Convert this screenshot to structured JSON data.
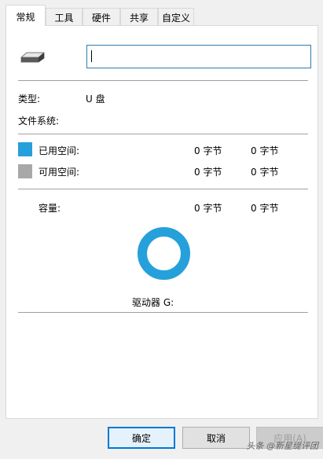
{
  "tabs": [
    {
      "label": "常规",
      "active": true
    },
    {
      "label": "工具",
      "active": false
    },
    {
      "label": "硬件",
      "active": false
    },
    {
      "label": "共享",
      "active": false
    },
    {
      "label": "自定义",
      "active": false
    }
  ],
  "drive": {
    "icon": "usb-drive-icon",
    "name_value": ""
  },
  "info": {
    "type_label": "类型:",
    "type_value": "U 盘",
    "fs_label": "文件系统:",
    "fs_value": ""
  },
  "space": {
    "used_label": "已用空间:",
    "used_bytes": "0 字节",
    "used_size": "0 字节",
    "used_color": "#26a0da",
    "free_label": "可用空间:",
    "free_bytes": "0 字节",
    "free_size": "0 字节",
    "free_color": "#a8a8a8",
    "capacity_label": "容量:",
    "capacity_bytes": "0 字节",
    "capacity_size": "0 字节"
  },
  "chart_color": "#26a0da",
  "drive_label": "驱动器 G:",
  "buttons": {
    "ok": "确定",
    "cancel": "取消",
    "apply": "应用(A)"
  },
  "watermark": "头条 @新星缇评团"
}
